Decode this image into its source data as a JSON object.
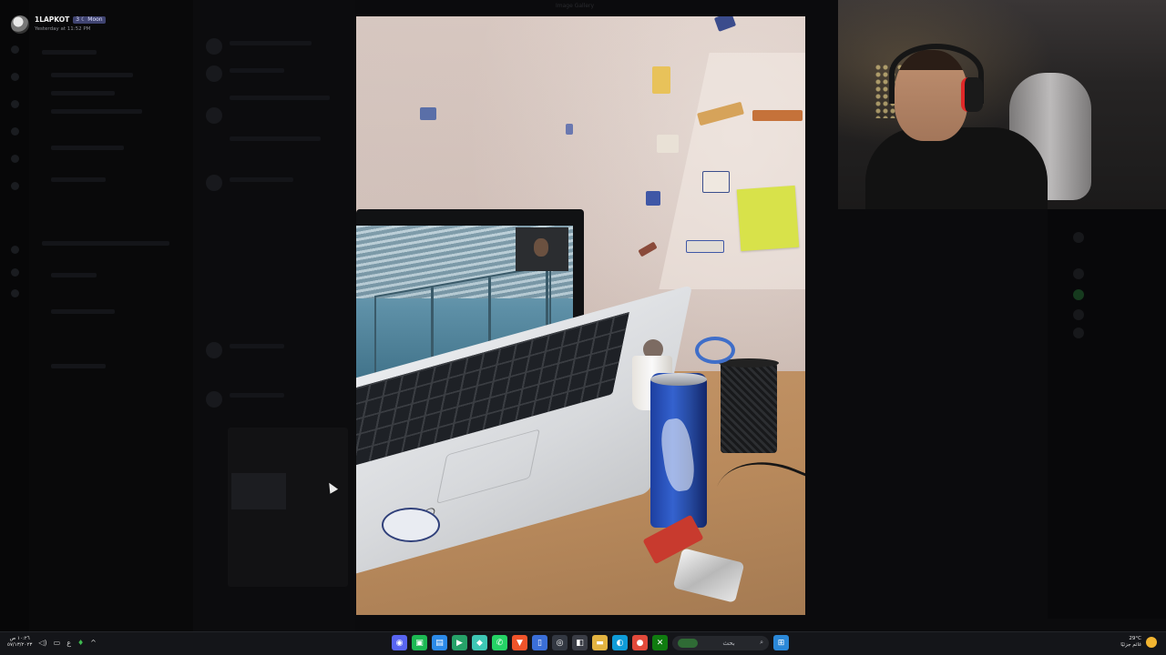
{
  "viewer": {
    "username": "1LAPKOT",
    "user_tag": "3 ☾ Moon",
    "timestamp": "Yesterday at 11:52 PM",
    "top_title": "Image Gallery"
  },
  "taskbar": {
    "clock_time": "١٠:٢٦ ص",
    "clock_date": "٥٧/١٣/٢٠٢٣",
    "language": "ع",
    "search_placeholder": "بحث",
    "weather_temp": "29°C",
    "weather_desc": "غائم جزئيًا",
    "apps": [
      {
        "name": "discord-icon",
        "glyph": "◉",
        "color": "#5865f2"
      },
      {
        "name": "spotify-like-icon",
        "glyph": "▣",
        "color": "#1db954"
      },
      {
        "name": "explorer-icon",
        "glyph": "▤",
        "color": "#2c8ae8"
      },
      {
        "name": "play-icon",
        "glyph": "▶",
        "color": "#26a269"
      },
      {
        "name": "photos-icon",
        "glyph": "◆",
        "color": "#3ec7b5"
      },
      {
        "name": "whatsapp-icon",
        "glyph": "✆",
        "color": "#25d366"
      },
      {
        "name": "brave-icon",
        "glyph": "▼",
        "color": "#f0542b"
      },
      {
        "name": "notes-icon",
        "glyph": "▯",
        "color": "#3b6fd8"
      },
      {
        "name": "obs-icon",
        "glyph": "◎",
        "color": "#333842"
      },
      {
        "name": "store-icon",
        "glyph": "◧",
        "color": "#3a3d46"
      },
      {
        "name": "folder-icon",
        "glyph": "▬",
        "color": "#e3b341"
      },
      {
        "name": "edge-icon",
        "glyph": "◐",
        "color": "#0f9cd8"
      },
      {
        "name": "chrome-icon",
        "glyph": "●",
        "color": "#e24a3b"
      },
      {
        "name": "xbox-icon",
        "glyph": "✕",
        "color": "#107c10"
      }
    ]
  }
}
